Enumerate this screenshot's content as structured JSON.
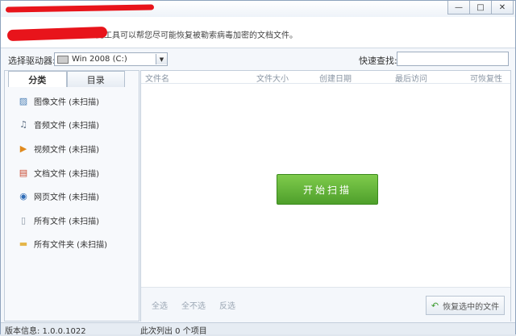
{
  "window": {
    "minimize_glyph": "—",
    "maximize_glyph": "□",
    "close_glyph": "✕"
  },
  "info": {
    "text": "此工具可以帮您尽可能恢复被勒索病毒加密的文档文件。"
  },
  "drive": {
    "label": "选择驱动器:",
    "value": "Win 2008 (C:)",
    "arrow": "▼"
  },
  "search": {
    "label": "快速查找:",
    "value": ""
  },
  "tabs": [
    {
      "label": "分类",
      "active": true
    },
    {
      "label": "目录",
      "active": false
    }
  ],
  "categories": [
    {
      "icon": "image-file-icon",
      "glyph": "▨",
      "color": "#4a7fb5",
      "label": "图像文件 (未扫描)"
    },
    {
      "icon": "audio-file-icon",
      "glyph": "♫",
      "color": "#5a6c80",
      "label": "音频文件 (未扫描)"
    },
    {
      "icon": "video-file-icon",
      "glyph": "▶",
      "color": "#e08a1e",
      "label": "视频文件 (未扫描)"
    },
    {
      "icon": "document-file-icon",
      "glyph": "▤",
      "color": "#c9472e",
      "label": "文档文件 (未扫描)"
    },
    {
      "icon": "webpage-file-icon",
      "glyph": "◉",
      "color": "#2f6cb7",
      "label": "网页文件 (未扫描)"
    },
    {
      "icon": "all-files-icon",
      "glyph": "▯",
      "color": "#8a96a4",
      "label": "所有文件 (未扫描)"
    },
    {
      "icon": "folder-icon",
      "glyph": "▬",
      "color": "#e5b64a",
      "label": "所有文件夹 (未扫描)"
    }
  ],
  "columns": [
    "文件名",
    "文件大小",
    "创建日期",
    "最后访问",
    "可恢复性"
  ],
  "scan_button": "开始扫描",
  "selection": {
    "select_all": "全选",
    "select_none": "全不选",
    "invert": "反选"
  },
  "recover_button": {
    "label": "恢复选中的文件",
    "glyph": "↶"
  },
  "status": {
    "version": "版本信息: 1.0.0.1022",
    "list": "此次列出 0 个项目"
  }
}
